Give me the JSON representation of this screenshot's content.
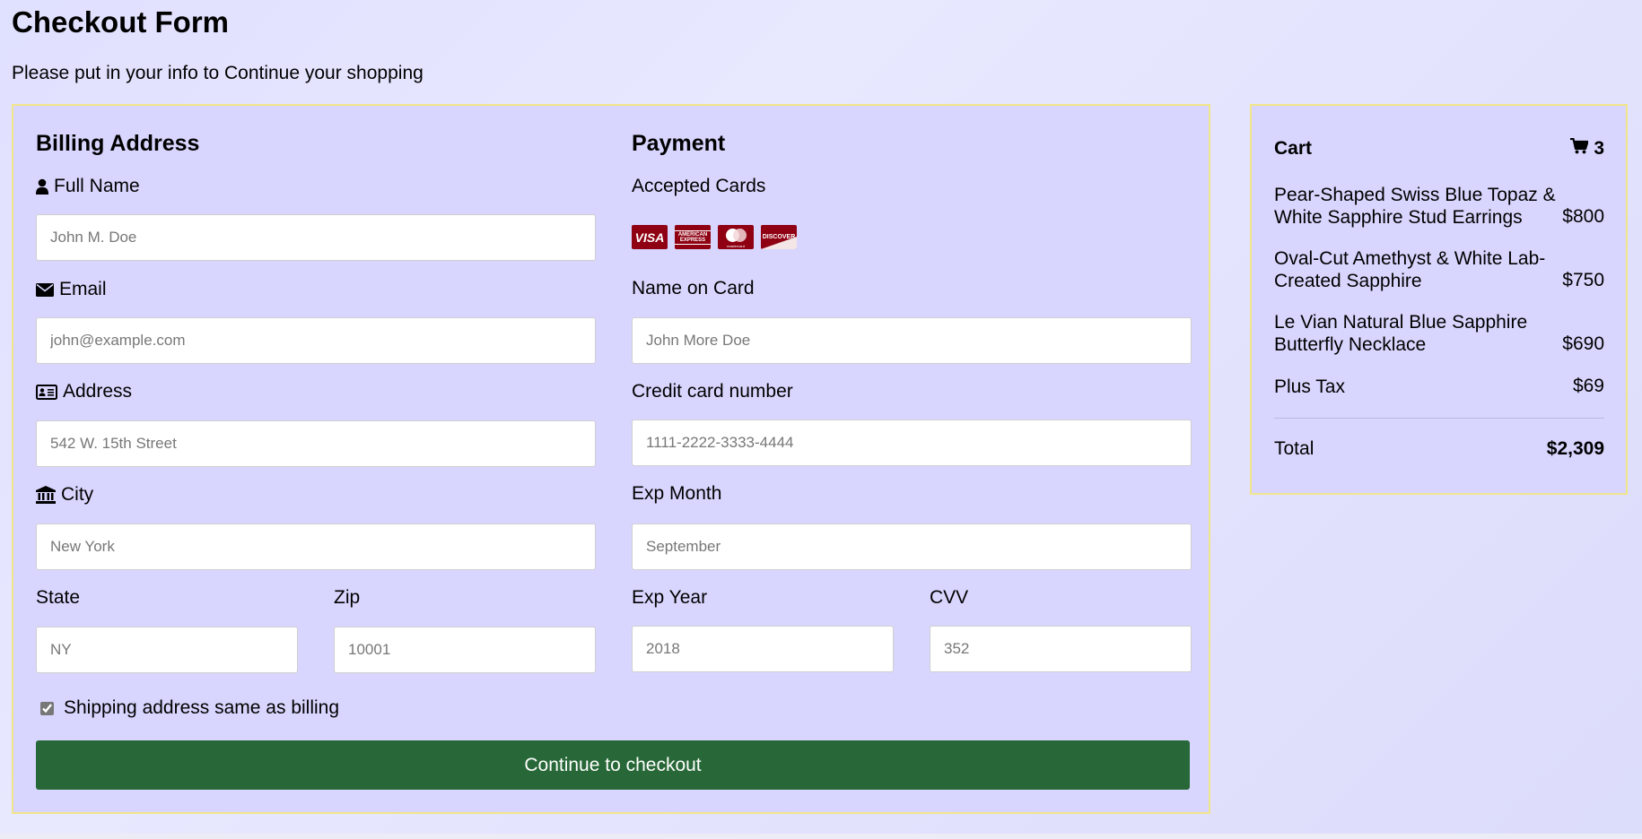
{
  "page": {
    "title": "Checkout Form",
    "subtitle": "Please put in your info to Continue your shopping"
  },
  "billing": {
    "heading": "Billing Address",
    "full_name": {
      "label": "Full Name",
      "icon": "user-icon",
      "placeholder": "John M. Doe"
    },
    "email": {
      "label": "Email",
      "icon": "envelope-icon",
      "placeholder": "john@example.com"
    },
    "address": {
      "label": "Address",
      "icon": "address-card-icon",
      "placeholder": "542 W. 15th Street"
    },
    "city": {
      "label": "City",
      "icon": "institution-icon",
      "placeholder": "New York"
    },
    "state": {
      "label": "State",
      "placeholder": "NY"
    },
    "zip": {
      "label": "Zip",
      "placeholder": "10001"
    }
  },
  "payment": {
    "heading": "Payment",
    "accepted_cards_label": "Accepted Cards",
    "cards": [
      {
        "name": "visa",
        "text": "VISA"
      },
      {
        "name": "american-express",
        "text": "AMERICAN EXPRESS"
      },
      {
        "name": "mastercard",
        "text": "mastercard"
      },
      {
        "name": "discover",
        "text": "DISCOVER"
      }
    ],
    "name_on_card": {
      "label": "Name on Card",
      "placeholder": "John More Doe"
    },
    "card_number": {
      "label": "Credit card number",
      "placeholder": "1111-2222-3333-4444"
    },
    "exp_month": {
      "label": "Exp Month",
      "placeholder": "September"
    },
    "exp_year": {
      "label": "Exp Year",
      "placeholder": "2018"
    },
    "cvv": {
      "label": "CVV",
      "placeholder": "352"
    }
  },
  "shipping_same": {
    "label": "Shipping address same as billing",
    "checked": true
  },
  "submit_label": "Continue to checkout",
  "cart": {
    "title": "Cart",
    "count": "3",
    "items": [
      {
        "name": "Pear-Shaped Swiss Blue Topaz & White Sapphire Stud Earrings",
        "price": "$800"
      },
      {
        "name": "Oval-Cut Amethyst & White Lab-Created Sapphire",
        "price": "$750"
      },
      {
        "name": "Le Vian Natural Blue Sapphire Butterfly Necklace",
        "price": "$690"
      }
    ],
    "tax": {
      "label": "Plus Tax",
      "value": "$69"
    },
    "total": {
      "label": "Total",
      "value": "$2,309"
    }
  },
  "colors": {
    "panel_bg": "#d8d6fe",
    "panel_border": "#f0e58a",
    "button_bg": "#286838",
    "card_logo_bg": "#8e0012"
  }
}
